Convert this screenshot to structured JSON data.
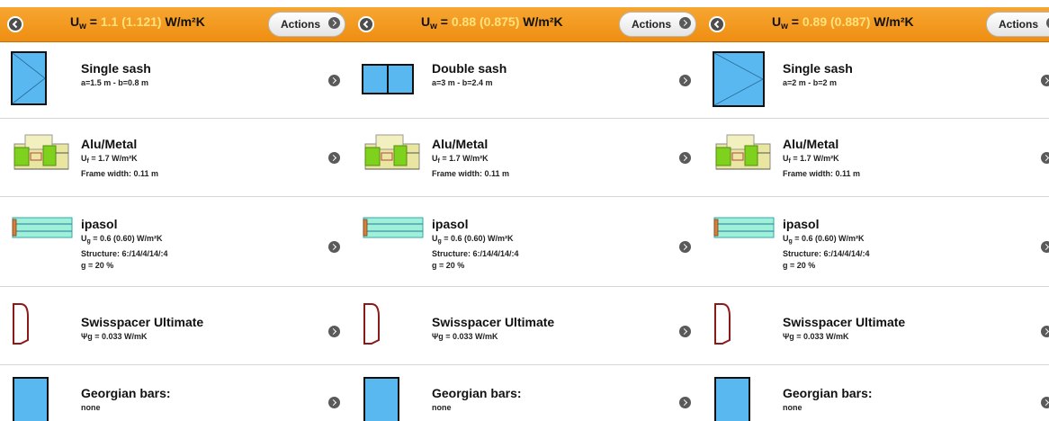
{
  "panels": [
    {
      "header": {
        "title_prefix": "U",
        "title_sub": "w",
        "title_eq": " = ",
        "title_value": "1.1 (1.121)",
        "title_unit": " W/m²K",
        "actions_label": "Actions"
      },
      "rows": {
        "sash": {
          "title": "Single sash",
          "line1": "a=1.5 m - b=0.8 m"
        },
        "frame": {
          "title": "Alu/Metal",
          "uf_prefix": "U",
          "uf_sub": "f",
          "uf_value": " = 1.7 W/m²K",
          "width": "Frame width: 0.11 m"
        },
        "glazing": {
          "title": "ipasol",
          "ug_prefix": "U",
          "ug_sub": "g",
          "ug_value": " = 0.6 (0.60) W/m²K",
          "structure": "Structure: 6:/14/4/14/:4",
          "g": "g = 20 %"
        },
        "spacer": {
          "title": "Swisspacer Ultimate",
          "psi": "Ψg = 0.033 W/mK"
        },
        "bars": {
          "title": "Georgian bars:",
          "value": "none"
        }
      }
    },
    {
      "header": {
        "title_prefix": "U",
        "title_sub": "w",
        "title_eq": " = ",
        "title_value": "0.88 (0.875)",
        "title_unit": " W/m²K",
        "actions_label": "Actions"
      },
      "rows": {
        "sash": {
          "title": "Double sash",
          "line1": "a=3 m - b=2.4 m"
        },
        "frame": {
          "title": "Alu/Metal",
          "uf_prefix": "U",
          "uf_sub": "f",
          "uf_value": " = 1.7 W/m²K",
          "width": "Frame width: 0.11 m"
        },
        "glazing": {
          "title": "ipasol",
          "ug_prefix": "U",
          "ug_sub": "g",
          "ug_value": " = 0.6 (0.60) W/m²K",
          "structure": "Structure: 6:/14/4/14/:4",
          "g": "g = 20 %"
        },
        "spacer": {
          "title": "Swisspacer Ultimate",
          "psi": "Ψg = 0.033 W/mK"
        },
        "bars": {
          "title": "Georgian bars:",
          "value": "none"
        }
      }
    },
    {
      "header": {
        "title_prefix": "U",
        "title_sub": "w",
        "title_eq": " = ",
        "title_value": "0.89 (0.887)",
        "title_unit": " W/m²K",
        "actions_label": "Actions"
      },
      "rows": {
        "sash": {
          "title": "Single sash",
          "line1": "a=2 m - b=2 m"
        },
        "frame": {
          "title": "Alu/Metal",
          "uf_prefix": "U",
          "uf_sub": "f",
          "uf_value": " = 1.7 W/m²K",
          "width": "Frame width: 0.11 m"
        },
        "glazing": {
          "title": "ipasol",
          "ug_prefix": "U",
          "ug_sub": "g",
          "ug_value": " = 0.6 (0.60) W/m²K",
          "structure": "Structure: 6:/14/4/14/:4",
          "g": "g = 20 %"
        },
        "spacer": {
          "title": "Swisspacer Ultimate",
          "psi": "Ψg = 0.033 W/mK"
        },
        "bars": {
          "title": "Georgian bars:",
          "value": "none"
        }
      }
    }
  ],
  "colors": {
    "header": "#f29a20",
    "header_value_highlight": "#ffe27a",
    "glass": "#5ab8f0",
    "frame_green": "#7ed21e",
    "spacer_red": "#8b1a1a"
  },
  "icons": [
    "back-icon",
    "chevron-right-icon",
    "single-sash-icon",
    "double-sash-icon",
    "frame-profile-icon",
    "glazing-icon",
    "spacer-icon",
    "georgian-bars-icon"
  ]
}
